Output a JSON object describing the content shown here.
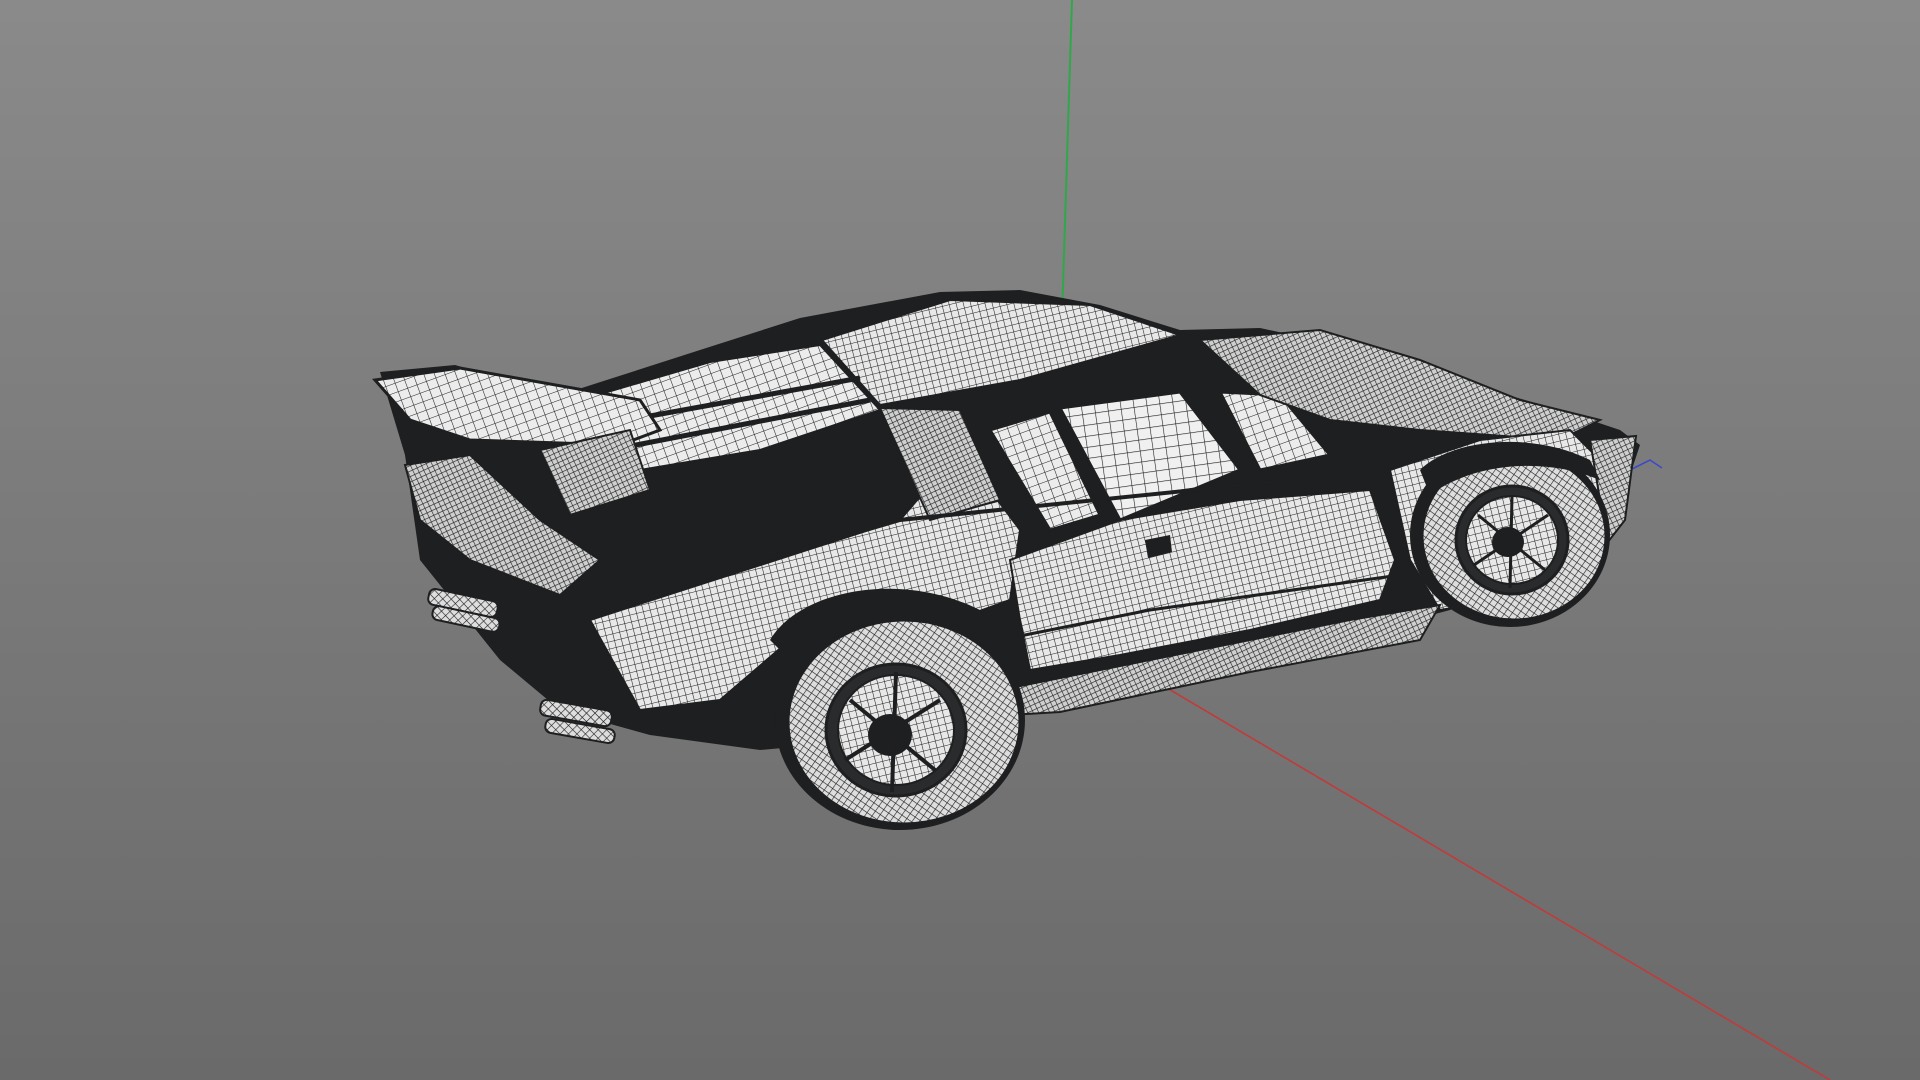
{
  "viewport": {
    "type": "3d-perspective-viewport",
    "display_mode": "wireframe",
    "background_top": "#8a8a8a",
    "background_bottom": "#6a6a6a",
    "wire_color": "#1e1f20",
    "panel_fill": "#e6e6e6"
  },
  "scene": {
    "object": "sports-car-wireframe-model",
    "axes": {
      "x_axis_color": "#c23a3a",
      "y_axis_color": "#2fa84a",
      "z_axis_color": "#3a4ac8"
    }
  }
}
